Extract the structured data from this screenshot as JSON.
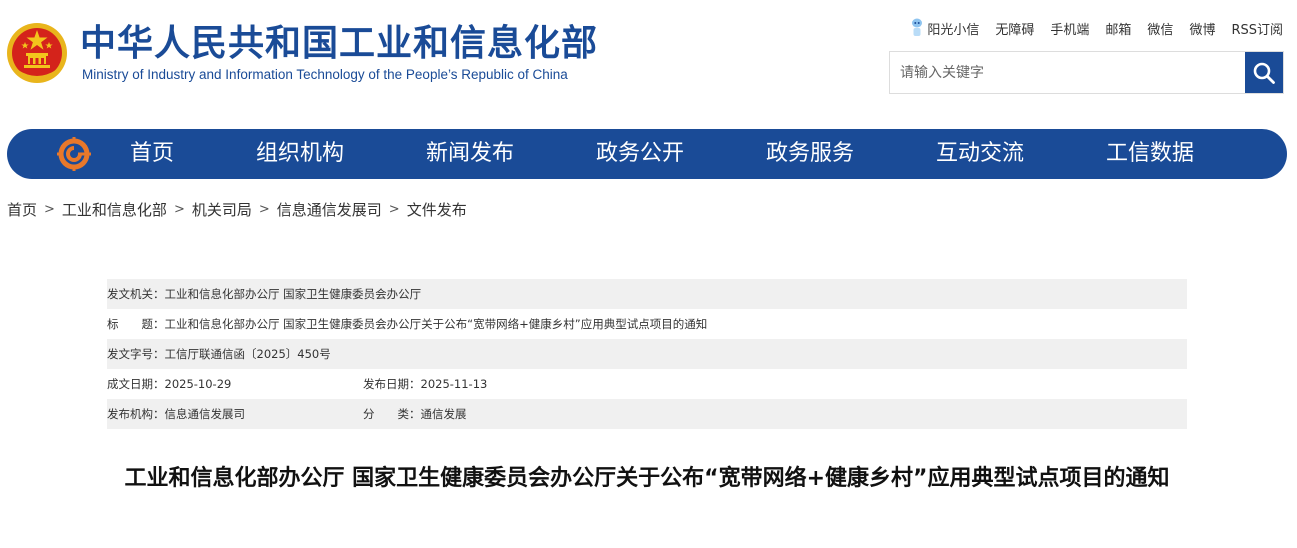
{
  "header": {
    "title_cn": "中华人民共和国工业和信息化部",
    "title_en": "Ministry of Industry and Information Technology of the People’s Republic of China"
  },
  "toplinks": [
    "阳光小信",
    "无障碍",
    "手机端",
    "邮箱",
    "微信",
    "微博",
    "RSS订阅"
  ],
  "search": {
    "placeholder": "请输入关键字"
  },
  "nav": [
    "首页",
    "组织机构",
    "新闻发布",
    "政务公开",
    "政务服务",
    "互动交流",
    "工信数据"
  ],
  "breadcrumb": [
    "首页",
    "工业和信息化部",
    "机关司局",
    "信息通信发展司",
    "文件发布"
  ],
  "breadcrumb_sep": ">",
  "meta": {
    "issuer": "发文机关：工业和信息化部办公厅 国家卫生健康委员会办公厅",
    "subject": "标　　题：工业和信息化部办公厅 国家卫生健康委员会办公厅关于公布“宽带网络+健康乡村”应用典型试点项目的通知",
    "doc_no": "发文字号：工信厅联通信函〔2025〕450号",
    "created": "成文日期：2025-10-29",
    "published": "发布日期：2025-11-13",
    "agency": "发布机构：信息通信发展司",
    "category": "分　　类：通信发展"
  },
  "doc_title": "工业和信息化部办公厅 国家卫生健康委员会办公厅关于公布“宽带网络+健康乡村”应用典型试点项目的通知",
  "colors": {
    "brand": "#1a4b97",
    "row_shade": "#f0f0f0",
    "emblem_red": "#d4231b",
    "emblem_gold": "#f3c51c"
  }
}
